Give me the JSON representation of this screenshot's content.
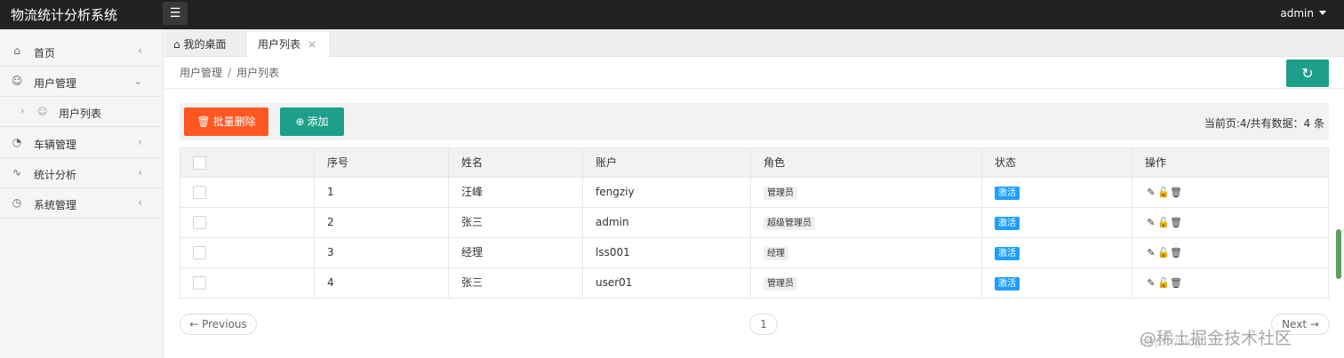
{
  "header": {
    "app_title": "物流统计分析系统",
    "menu_icon": "hamburger-icon",
    "user": "admin"
  },
  "sidebar": {
    "items": [
      {
        "label": "首页",
        "icon": "home-icon"
      },
      {
        "label": "用户管理",
        "icon": "user-icon"
      },
      {
        "label": "车辆管理",
        "icon": "vehicle-icon"
      },
      {
        "label": "统计分析",
        "icon": "pulse-icon"
      },
      {
        "label": "系统管理",
        "icon": "dashboard-icon"
      }
    ],
    "subitem": {
      "label": "用户列表",
      "icon": "user-small-icon"
    }
  },
  "tabs": [
    {
      "label": "我的桌面",
      "icon": "home-icon"
    },
    {
      "label": "用户列表",
      "close": "×"
    }
  ],
  "breadcrumb": {
    "root": "用户管理",
    "sep": "/",
    "current": "用户列表"
  },
  "toolbar": {
    "delete_label": "批量删除",
    "add_label": "添加",
    "page_info": "当前页:4/共有数据：4 条"
  },
  "table": {
    "headers": [
      "序号",
      "姓名",
      "账户",
      "角色",
      "状态",
      "操作"
    ],
    "rows": [
      {
        "id": "1",
        "name": "汪峰",
        "account": "fengziy",
        "role": "管理员",
        "status": "激活"
      },
      {
        "id": "2",
        "name": "张三",
        "account": "admin",
        "role": "超级管理员",
        "status": "激活"
      },
      {
        "id": "3",
        "name": "经理",
        "account": "lss001",
        "role": "经理",
        "status": "激活"
      },
      {
        "id": "4",
        "name": "张三",
        "account": "user01",
        "role": "管理员",
        "status": "激活"
      }
    ]
  },
  "pagination": {
    "prev": "← Previous",
    "page": "1",
    "next": "Next →"
  },
  "watermark": {
    "text": "@稀土掘金技术社区",
    "url": "https://blog"
  },
  "colors": {
    "topbar": "#222222",
    "danger": "#ff5722",
    "primary": "#1e9f89",
    "status": "#1e9fff"
  }
}
